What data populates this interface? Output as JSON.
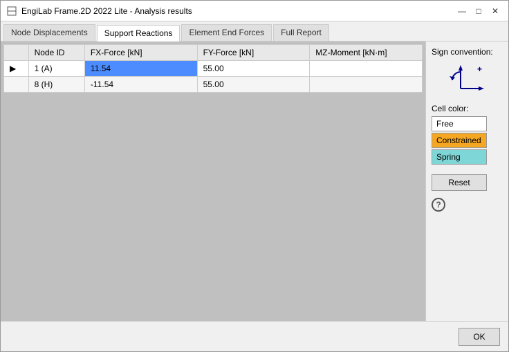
{
  "window": {
    "title": "EngiLab Frame.2D 2022 Lite - Analysis results",
    "controls": {
      "minimize": "—",
      "maximize": "□",
      "close": "✕"
    }
  },
  "tabs": [
    {
      "id": "node-displacements",
      "label": "Node Displacements",
      "active": false
    },
    {
      "id": "support-reactions",
      "label": "Support Reactions",
      "active": true
    },
    {
      "id": "element-end-forces",
      "label": "Element End Forces",
      "active": false
    },
    {
      "id": "full-report",
      "label": "Full Report",
      "active": false
    }
  ],
  "table": {
    "columns": [
      {
        "id": "arrow",
        "label": ""
      },
      {
        "id": "node-id",
        "label": "Node ID"
      },
      {
        "id": "fx-force",
        "label": "FX-Force [kN]"
      },
      {
        "id": "fy-force",
        "label": "FY-Force [kN]"
      },
      {
        "id": "mz-moment",
        "label": "MZ-Moment [kN·m]"
      }
    ],
    "rows": [
      {
        "arrow": "▶",
        "node_id": "1 (A)",
        "fx": "11.54",
        "fy": "55.00",
        "mz": "",
        "selected": true
      },
      {
        "arrow": "",
        "node_id": "8 (H)",
        "fx": "-11.54",
        "fy": "55.00",
        "mz": "",
        "selected": false
      }
    ]
  },
  "right_panel": {
    "sign_convention_label": "Sign convention:",
    "cell_color_label": "Cell color:",
    "colors": [
      {
        "id": "free",
        "label": "Free",
        "class": "color-free"
      },
      {
        "id": "constrained",
        "label": "Constrained",
        "class": "color-constrained"
      },
      {
        "id": "spring",
        "label": "Spring",
        "class": "color-spring"
      }
    ],
    "reset_label": "Reset",
    "help_label": "?"
  },
  "footer": {
    "ok_label": "OK"
  }
}
